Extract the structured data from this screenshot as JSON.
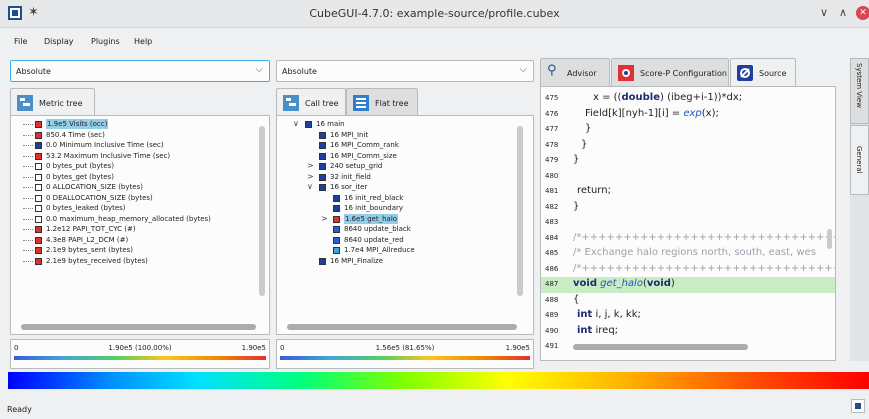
{
  "window": {
    "title": "CubeGUI-4.7.0: example-source/profile.cubex",
    "pin_icon": "pin-icon",
    "minimize_glyph": "∨",
    "maximize_glyph": "∧",
    "close_glyph": "✕"
  },
  "menu": {
    "items": [
      {
        "label": "File"
      },
      {
        "label": "Display"
      },
      {
        "label": "Plugins"
      },
      {
        "label": "Help"
      }
    ]
  },
  "metric_panel": {
    "mode": "Absolute",
    "tab_label": "Metric tree",
    "items": [
      {
        "label": "1.9e5 Visits (occ)",
        "color": "#e03131",
        "selected": true
      },
      {
        "label": "850.4 Time (sec)",
        "color": "#e03131"
      },
      {
        "label": "0.0 Minimum Inclusive Time (sec)",
        "color": "#1f3f9f"
      },
      {
        "label": "53.2 Maximum Inclusive Time (sec)",
        "color": "#e03131"
      },
      {
        "label": "0 bytes_put (bytes)",
        "color": "#ffffff"
      },
      {
        "label": "0 bytes_get (bytes)",
        "color": "#ffffff"
      },
      {
        "label": "0 ALLOCATION_SIZE (bytes)",
        "color": "#ffffff"
      },
      {
        "label": "0 DEALLOCATION_SIZE (bytes)",
        "color": "#ffffff"
      },
      {
        "label": "0 bytes_leaked (bytes)",
        "color": "#ffffff"
      },
      {
        "label": "0.0 maximum_heap_memory_allocated (bytes)",
        "color": "#ffffff"
      },
      {
        "label": "1.2e12 PAPI_TOT_CYC (#)",
        "color": "#e03131"
      },
      {
        "label": "4.3e8 PAPI_L2_DCM (#)",
        "color": "#e03131"
      },
      {
        "label": "2.1e9 bytes_sent (bytes)",
        "color": "#e03131"
      },
      {
        "label": "2.1e9 bytes_received (bytes)",
        "color": "#e03131"
      }
    ],
    "stats": {
      "min": "0",
      "value": "1.90e5 (100.00%)",
      "max": "1.90e5"
    }
  },
  "call_panel": {
    "mode": "Absolute",
    "tabs": [
      {
        "label": "Call tree"
      },
      {
        "label": "Flat tree"
      }
    ],
    "items": [
      {
        "label": "16 main",
        "color": "#1f3f9f",
        "indent": 0,
        "expander": "∨"
      },
      {
        "label": "16 MPI_Init",
        "color": "#1f3f9f",
        "indent": 1,
        "expander": ""
      },
      {
        "label": "16 MPI_Comm_rank",
        "color": "#1f3f9f",
        "indent": 1,
        "expander": ""
      },
      {
        "label": "16 MPI_Comm_size",
        "color": "#1f3f9f",
        "indent": 1,
        "expander": ""
      },
      {
        "label": "240 setup_grid",
        "color": "#1f3f9f",
        "indent": 1,
        "expander": ">"
      },
      {
        "label": "32 init_field",
        "color": "#1f3f9f",
        "indent": 1,
        "expander": ">"
      },
      {
        "label": "16 sor_iter",
        "color": "#1f3f9f",
        "indent": 1,
        "expander": "∨"
      },
      {
        "label": "16 init_red_black",
        "color": "#1f3f9f",
        "indent": 2,
        "expander": ""
      },
      {
        "label": "16 init_boundary",
        "color": "#1f3f9f",
        "indent": 2,
        "expander": ""
      },
      {
        "label": "1.6e5 get_halo",
        "color": "#e03131",
        "indent": 2,
        "expander": ">",
        "selected": true
      },
      {
        "label": "8640 update_black",
        "color": "#2c5fd0",
        "indent": 2,
        "expander": ""
      },
      {
        "label": "8640 update_red",
        "color": "#2c5fd0",
        "indent": 2,
        "expander": ""
      },
      {
        "label": "1.7e4 MPI_Allreduce",
        "color": "#3fa7d6",
        "indent": 2,
        "expander": ""
      },
      {
        "label": "16 MPI_Finalize",
        "color": "#1f3f9f",
        "indent": 1,
        "expander": ""
      }
    ],
    "stats": {
      "min": "0",
      "value": "1.56e5 (81.65%)",
      "max": "1.90e5"
    }
  },
  "right_panel": {
    "tabs": [
      {
        "label": "Advisor",
        "icon": "advisor-icon"
      },
      {
        "label": "Score-P Configuration",
        "icon": "scorep-icon"
      },
      {
        "label": "Source",
        "icon": "source-icon"
      }
    ],
    "code_lines": [
      {
        "num": "475",
        "html": "x = ((<span class='kw'>double</span>) (ibeg+i-1))*dx;",
        "indent": 20
      },
      {
        "num": "476",
        "html": "Field[k][nyh-1][i] = <span class='fn'>exp</span>(x);",
        "indent": 12
      },
      {
        "num": "477",
        "html": "}",
        "indent": 12
      },
      {
        "num": "478",
        "html": "}",
        "indent": 8
      },
      {
        "num": "479",
        "html": "}",
        "indent": 0
      },
      {
        "num": "480",
        "html": "",
        "indent": 0
      },
      {
        "num": "481",
        "html": "return;",
        "indent": 4
      },
      {
        "num": "482",
        "html": "}",
        "indent": 0
      },
      {
        "num": "483",
        "html": "",
        "indent": 0
      },
      {
        "num": "484",
        "html": "<span class='cm'>/*+++++++++++++++++++++++++++++++++++++++++</span>",
        "indent": 0
      },
      {
        "num": "485",
        "html": "<span class='cm'>/* Exchange halo regions north, south, east, wes</span>",
        "indent": 0
      },
      {
        "num": "486",
        "html": "<span class='cm'>/*+++++++++++++++++++++++++++++++++++++++++</span>",
        "indent": 0
      },
      {
        "num": "487",
        "html": "<span class='kw'>void</span> <span class='fn'>get_halo</span>(<span class='kw'>void</span>)",
        "indent": 0,
        "highlight": true
      },
      {
        "num": "488",
        "html": "{",
        "indent": 0
      },
      {
        "num": "489",
        "html": "<span class='kw'>int</span> i, j, k, kk;",
        "indent": 4
      },
      {
        "num": "490",
        "html": "<span class='kw'>int</span> ireq;",
        "indent": 4
      },
      {
        "num": "491",
        "html": "",
        "indent": 0
      }
    ]
  },
  "side_tabs": [
    {
      "label": "System View"
    },
    {
      "label": "General"
    }
  ],
  "status": {
    "text": "Ready"
  }
}
